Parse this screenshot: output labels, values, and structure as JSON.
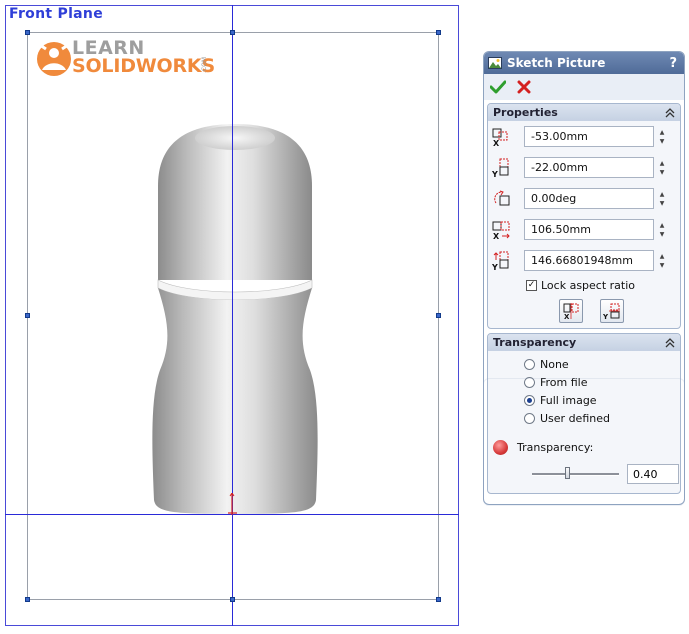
{
  "canvas": {
    "plane_label": "Front Plane",
    "logo": {
      "line1": "LEARN",
      "line2": "SOLIDWORKS",
      "suffix": ".COM"
    }
  },
  "property_manager": {
    "title": "Sketch Picture",
    "help_label": "?",
    "properties": {
      "header": "Properties",
      "x_position": "-53.00mm",
      "y_position": "-22.00mm",
      "angle": "0.00deg",
      "width": "106.50mm",
      "height": "146.66801948mm",
      "lock_aspect_ratio_label": "Lock aspect ratio",
      "lock_aspect_ratio_checked": true
    },
    "transparency": {
      "header": "Transparency",
      "options": [
        "None",
        "From file",
        "Full image",
        "User defined"
      ],
      "selected": "Full image",
      "slider_label": "Transparency:",
      "value": "0.40",
      "slider_fraction": 0.4
    }
  },
  "colors": {
    "sketch_line": "#2a2ad8",
    "plane_label": "#2f3fd8",
    "logo_orange": "#f08a3c",
    "accept_green": "#2e9e2e",
    "cancel_red": "#d42020"
  },
  "icons": [
    "picture-icon",
    "accept-check-icon",
    "cancel-x-icon",
    "collapse-chevrons-icon",
    "x-position-icon",
    "y-position-icon",
    "rotate-angle-icon",
    "width-icon",
    "height-icon",
    "flip-horizontal-icon",
    "flip-vertical-icon",
    "transparency-ball-icon"
  ]
}
